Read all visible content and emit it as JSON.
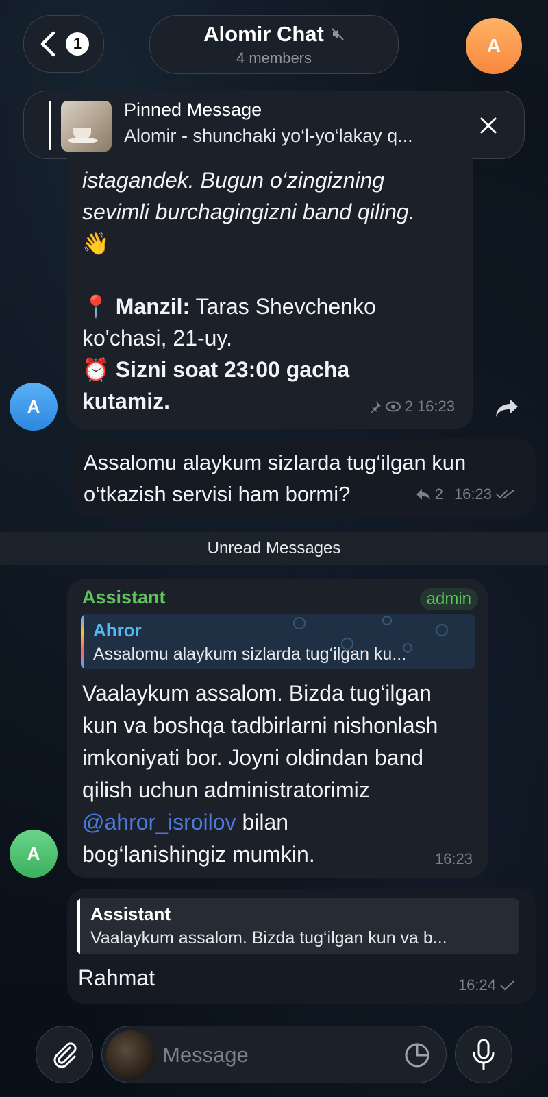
{
  "header": {
    "back_badge": "1",
    "chat_title": "Alomir Chat",
    "members": "4 members",
    "avatar_letter": "A"
  },
  "pinned": {
    "title": "Pinned Message",
    "text": "Alomir - shunchaki yo‘l-yo‘lakay q..."
  },
  "messages": [
    {
      "line1": "istagandek. Bugun o‘zingizning",
      "line2": "sevimli burchagingizni band qiling.",
      "emoji": "👋",
      "address_label": "Manzil:",
      "address_value": " Taras Shevchenko",
      "address_line2": "ko'chasi, 21-uy.",
      "time_line1": "Sizni soat 23:00 gacha",
      "time_line2": "kutamiz.",
      "views": "2",
      "time": "16:23",
      "avatar_letter": "A"
    },
    {
      "line1": "Assalomu alaykum sizlarda tug‘ilgan kun",
      "line2": "o‘tkazish servisi ham bormi?",
      "replies": "2",
      "time": "16:23"
    },
    {
      "sender": "Assistant",
      "badge": "admin",
      "reply_name": "Ahror",
      "reply_text": "Assalomu alaykum sizlarda tug‘ilgan ku...",
      "line1": "Vaalaykum assalom. Bizda tug‘ilgan",
      "line2": "kun va boshqa tadbirlarni nishonlash",
      "line3": "imkoniyati bor. Joyni oldindan band",
      "line4": "qilish uchun administratorimiz",
      "mention": "@ahror_isroilov",
      "line5_rest": " bilan",
      "line6": "bog‘lanishingiz mumkin.",
      "time": "16:23",
      "avatar_letter": "A"
    },
    {
      "quote_name": "Assistant",
      "quote_text": "Vaalaykum assalom. Bizda tug‘ilgan kun va b...",
      "text": "Rahmat",
      "time": "16:24"
    }
  ],
  "unread_label": "Unread Messages",
  "composer": {
    "placeholder": "Message"
  },
  "colors": {
    "admin_green": "#5fc25a",
    "reply_blue": "#57b5f2",
    "mention_blue": "#4c7ad9",
    "header_avatar": "#f6873d"
  }
}
